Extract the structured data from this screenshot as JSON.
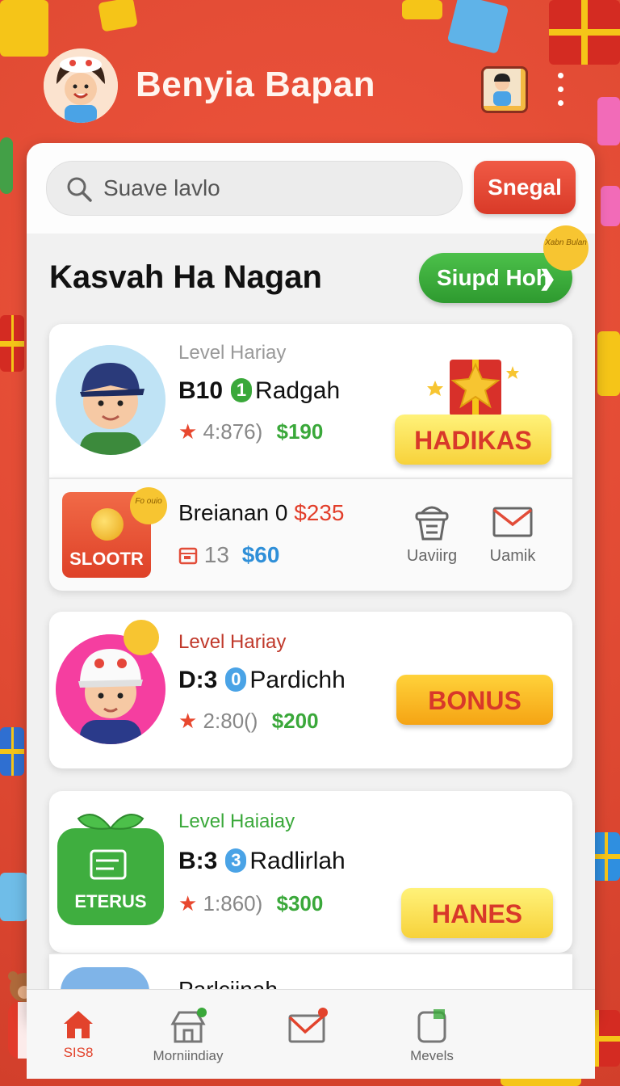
{
  "header": {
    "app_title": "Benyia Bapan"
  },
  "search": {
    "placeholder": "Suave lavlo",
    "button_label": "Snegal"
  },
  "section": {
    "title": "Kasvah Ha Nagan",
    "promo_button": "Siupd Hoh",
    "promo_badge": "Xabn Bulan"
  },
  "cards": [
    {
      "level_label": "Level Hariay",
      "level_color": "#999999",
      "code": "B10",
      "rank": "1",
      "rank_color": "#3aa83a",
      "name": "Radgah",
      "rating": "4:876)",
      "price": "$190",
      "action": "HADIKAS"
    },
    {
      "level_label": "Level Hariay",
      "level_color": "#c0392b",
      "code": "D:3",
      "rank": "0",
      "rank_color": "#4aa3e6",
      "name": "Pardichh",
      "rating": "2:80()",
      "price": "$200",
      "action": "BONUS"
    },
    {
      "level_label": "Level Haiaiay",
      "level_color": "#3aa83a",
      "code": "B:3",
      "rank": "3",
      "rank_color": "#4aa3e6",
      "name": "Radlirlah",
      "rating": "1:860)",
      "price": "$300",
      "action": "HANES",
      "badge_label": "ETERUS"
    }
  ],
  "sub_row": {
    "badge_label": "SLOOTR",
    "badge_corner": "Fo ouio",
    "title": "Breianan 0",
    "title_price": "$235",
    "count": "13",
    "price": "$60",
    "actions": [
      {
        "label": "Uaviirg"
      },
      {
        "label": "Uamik"
      }
    ]
  },
  "partial_card": {
    "name": "Parlciinah"
  },
  "nav": [
    {
      "label": "SIS8",
      "active": true
    },
    {
      "label": "Morniindiay",
      "active": false
    },
    {
      "label": "",
      "active": false
    },
    {
      "label": "Mevels",
      "active": false
    }
  ]
}
